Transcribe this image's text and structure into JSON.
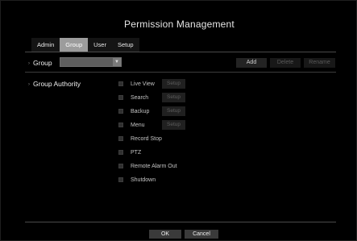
{
  "title": "Permission Management",
  "tabs": [
    {
      "label": "Admin",
      "active": false
    },
    {
      "label": "Group",
      "active": true
    },
    {
      "label": "User",
      "active": false
    },
    {
      "label": "Setup",
      "active": false
    }
  ],
  "group": {
    "label": "Group",
    "selected": "",
    "add_label": "Add",
    "delete_label": "Delete",
    "rename_label": "Rename"
  },
  "authority": {
    "label": "Group Authority",
    "setup_label": "Setup",
    "items": [
      {
        "label": "Live View",
        "checked": false
      },
      {
        "label": "Search",
        "checked": false
      },
      {
        "label": "Backup",
        "checked": false
      },
      {
        "label": "Menu",
        "checked": false
      },
      {
        "label": "Record Stop",
        "checked": false
      },
      {
        "label": "PTZ",
        "checked": false
      },
      {
        "label": "Remote Alarm Out",
        "checked": false
      },
      {
        "label": "Shutdown",
        "checked": false
      }
    ]
  },
  "footer": {
    "ok_label": "OK",
    "cancel_label": "Cancel"
  }
}
